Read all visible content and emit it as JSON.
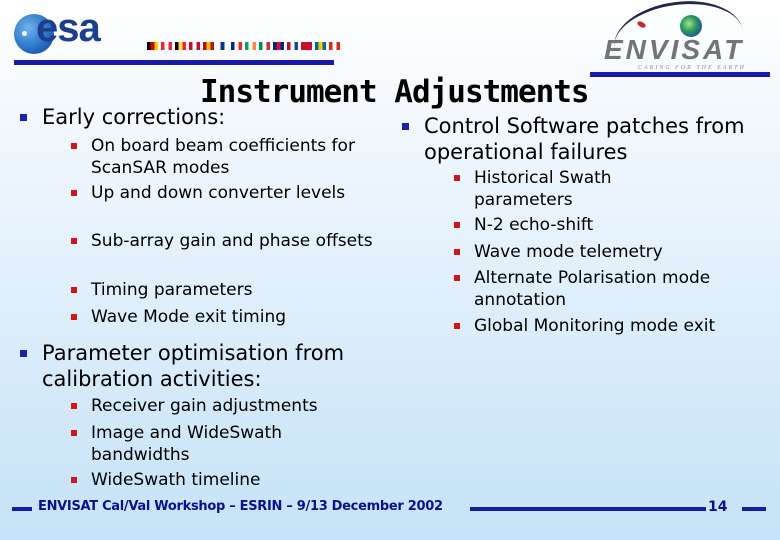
{
  "header": {
    "esa_logo_text": "esa",
    "envisat_logo_text": "ENVISAT",
    "envisat_tagline": "CARING FOR THE EARTH",
    "flags": [
      "#000000|#dd0000|#ffce00",
      "#ed2939|#ffffff|#ed2939",
      "#000000|#fae042|#ed2939",
      "#c60c30|#ffffff|#c60c30",
      "#aa151b|#f1bf00|#aa151b",
      "#ffffff|#003580|#ffffff",
      "#002395|#ffffff|#ed2939",
      "#169b62|#ffffff|#ff883e",
      "#009246|#ffffff|#ce2b37",
      "#00247d|#cf142b|#00247d",
      "#ae1c28|#ffffff|#21468b",
      "#c8102e|#c8102e|#c8102e",
      "#006aa7|#fecc00|#006aa7",
      "#d52b1e|#ffffff|#d52b1e"
    ],
    "colors": {
      "rule": "#1a1aa8",
      "bullet_level1": "#1a23a8",
      "bullet_level2": "#d01616",
      "footer_text": "#0e0e8e"
    }
  },
  "slide": {
    "title": "Instrument Adjustments",
    "left": {
      "early": {
        "heading": "Early corrections:",
        "items": [
          "On board beam coefficients for ScanSAR modes",
          "Up and down converter levels",
          "Sub-array gain and phase offsets",
          "Timing parameters",
          "Wave Mode exit timing"
        ]
      },
      "optimisation": {
        "heading": "Parameter optimisation from calibration activities:",
        "items": [
          "Receiver gain adjustments",
          "Image and WideSwath bandwidths",
          "WideSwath timeline"
        ]
      }
    },
    "right": {
      "heading": "Control Software patches from operational failures",
      "items": [
        "Historical Swath parameters",
        "N-2 echo-shift",
        "Wave mode telemetry",
        "Alternate Polarisation mode annotation",
        "Global Monitoring mode exit"
      ]
    }
  },
  "footer": {
    "text": "ENVISAT Cal/Val Workshop – ESRIN – 9/13 December 2002",
    "page_number": "14"
  }
}
